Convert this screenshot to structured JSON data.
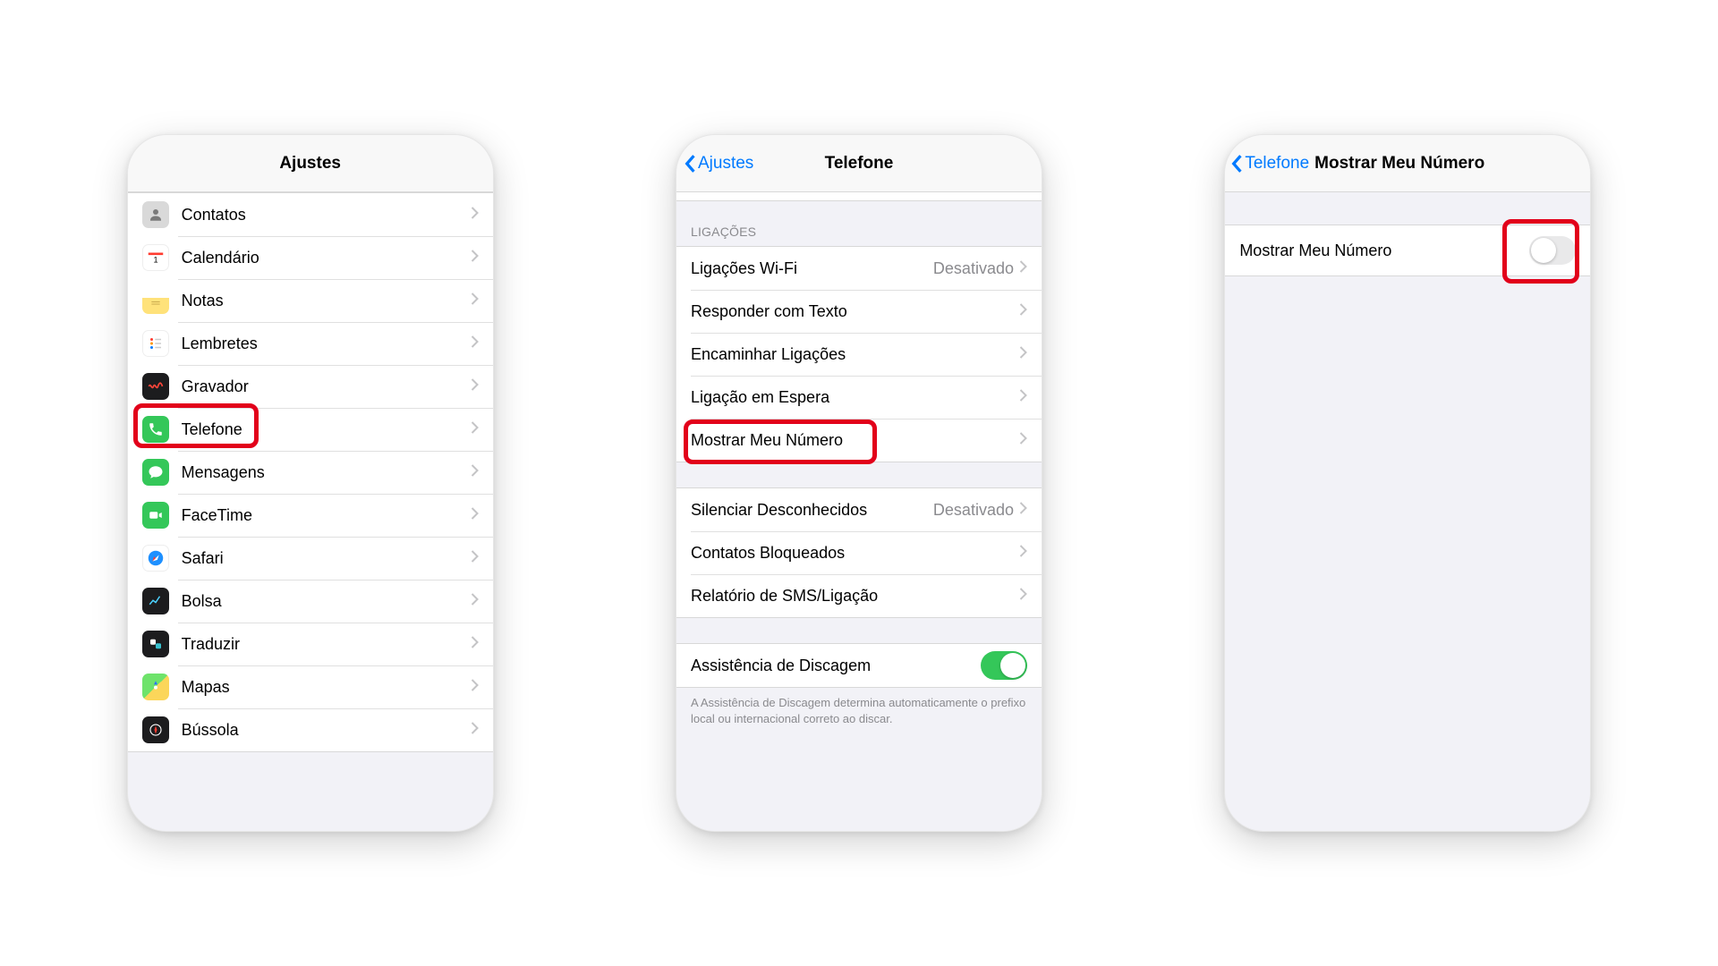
{
  "screen1": {
    "title": "Ajustes",
    "items": [
      {
        "label": "Contatos",
        "icon": "contacts"
      },
      {
        "label": "Calendário",
        "icon": "calendar"
      },
      {
        "label": "Notas",
        "icon": "notes"
      },
      {
        "label": "Lembretes",
        "icon": "reminders"
      },
      {
        "label": "Gravador",
        "icon": "recorder"
      },
      {
        "label": "Telefone",
        "icon": "phone"
      },
      {
        "label": "Mensagens",
        "icon": "messages"
      },
      {
        "label": "FaceTime",
        "icon": "facetime"
      },
      {
        "label": "Safari",
        "icon": "safari"
      },
      {
        "label": "Bolsa",
        "icon": "stocks"
      },
      {
        "label": "Traduzir",
        "icon": "translate"
      },
      {
        "label": "Mapas",
        "icon": "maps"
      },
      {
        "label": "Bússola",
        "icon": "compass"
      }
    ]
  },
  "screen2": {
    "back": "Ajustes",
    "title": "Telefone",
    "section_calls": "LIGAÇÕES",
    "rows_calls": [
      {
        "label": "Ligações Wi-Fi",
        "value": "Desativado"
      },
      {
        "label": "Responder com Texto",
        "value": ""
      },
      {
        "label": "Encaminhar Ligações",
        "value": ""
      },
      {
        "label": "Ligação em Espera",
        "value": ""
      },
      {
        "label": "Mostrar Meu Número",
        "value": ""
      }
    ],
    "rows_block": [
      {
        "label": "Silenciar Desconhecidos",
        "value": "Desativado"
      },
      {
        "label": "Contatos Bloqueados",
        "value": ""
      },
      {
        "label": "Relatório de SMS/Ligação",
        "value": ""
      }
    ],
    "assist_row": "Assistência de Discagem",
    "assist_footer": "A Assistência de Discagem determina automaticamente o prefixo local ou internacional correto ao discar."
  },
  "screen3": {
    "back": "Telefone",
    "title": "Mostrar Meu Número",
    "row_label": "Mostrar Meu Número"
  }
}
